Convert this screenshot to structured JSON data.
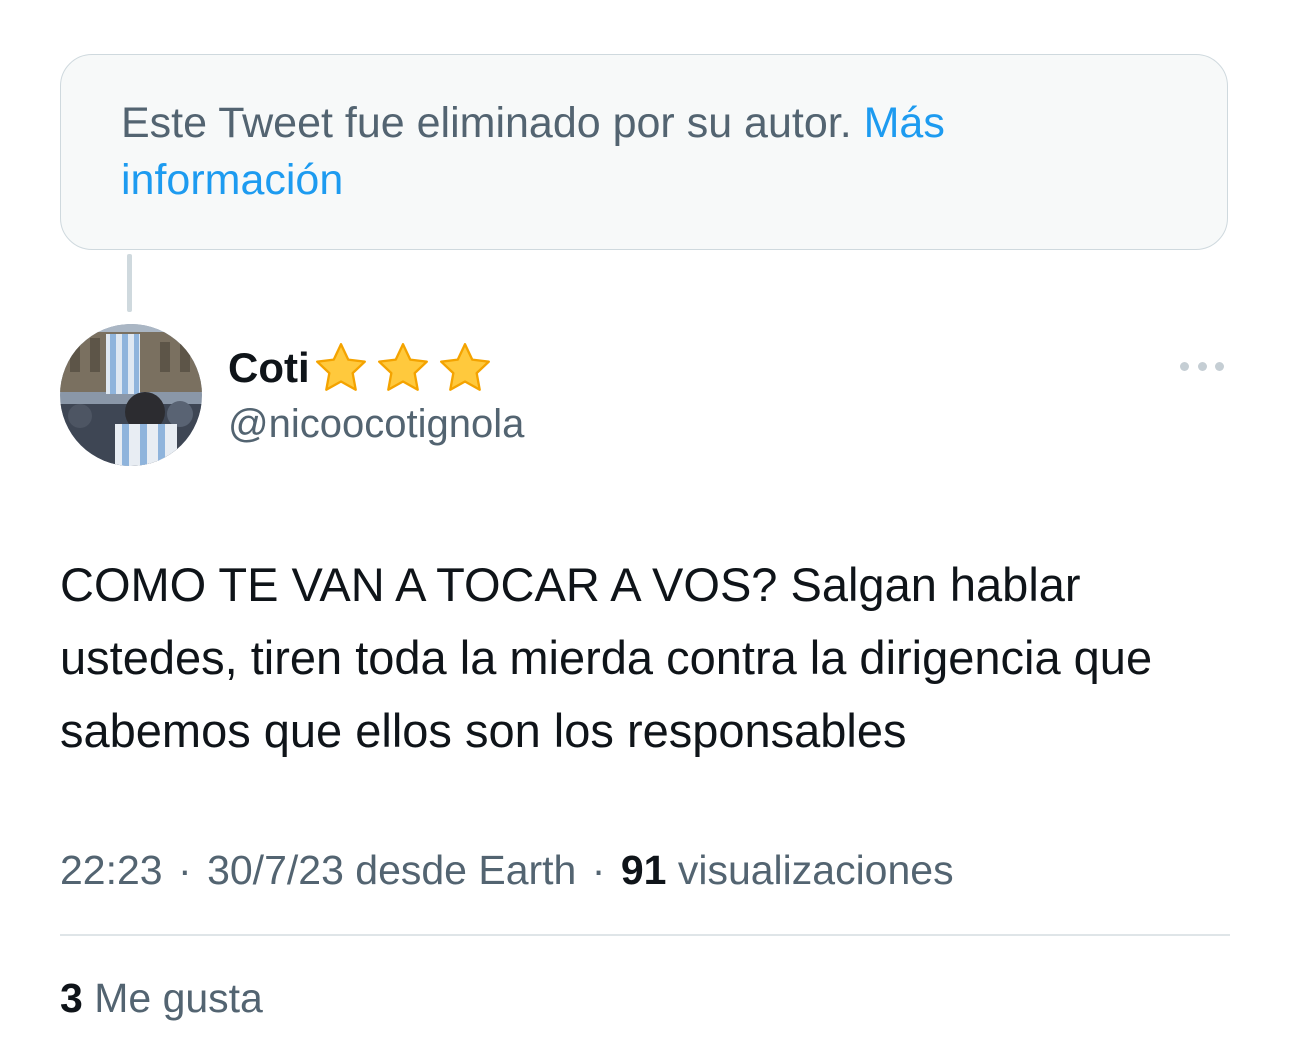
{
  "deleted_notice": {
    "text": "Este Tweet fue eliminado por su autor.",
    "link_label": "Más información"
  },
  "author": {
    "display_name": "Coti",
    "badge_emoji": [
      "star-emoji",
      "star-emoji",
      "star-emoji"
    ],
    "handle": "@nicoocotignola"
  },
  "tweet": {
    "text": "COMO TE VAN A TOCAR A VOS? Salgan hablar ustedes, tiren toda la mierda contra la dirigencia que sabemos que ellos son los responsables"
  },
  "meta": {
    "time": "22:23",
    "separator": "·",
    "date_source": "30/7/23 desde Earth",
    "views_count": "91",
    "views_label": "visualizaciones"
  },
  "likes": {
    "count": "3",
    "label": "Me gusta"
  },
  "colors": {
    "link": "#1d9bf0",
    "secondary_text": "#536471",
    "primary_text": "#0f1419",
    "border": "#cfd9de",
    "notice_bg": "#f7f9f9"
  }
}
